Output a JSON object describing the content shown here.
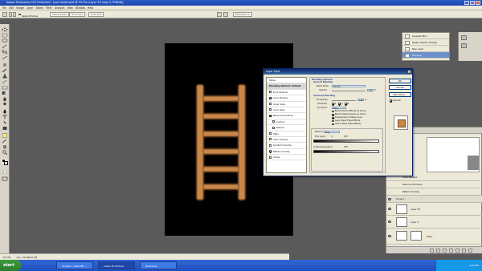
{
  "window": {
    "title": "Adobe Photoshop CS3 Extended - [sun ladder.psd @ 33.3% (Layer 32 copy 5, RGB/8)]",
    "controls": [
      "_",
      "□",
      "×"
    ]
  },
  "menu": [
    "File",
    "Edit",
    "Image",
    "Layer",
    "Select",
    "Filter",
    "Analysis",
    "View",
    "Window",
    "Help"
  ],
  "options_bar": {
    "resize_windows_label": "Resize Windows",
    "btn_actual_pixels": "Actual Pixels",
    "btn_fit_screen": "Fit Screen",
    "btn_print_size": "Print Size",
    "workspace_label": "Workspace ▾"
  },
  "status": {
    "zoom": "33.33%",
    "doc": "Doc: 30.4M/93.4M"
  },
  "history": {
    "items": [
      "Gaussian Blur",
      "Raster Opacity Change",
      "New Layer",
      "Fill Layer"
    ],
    "selected_index": 3
  },
  "layer_style": {
    "title": "Layer Style",
    "styles": [
      {
        "label": "Styles",
        "head": false,
        "check": null
      },
      {
        "label": "Blending Options: Default",
        "head": true,
        "check": null
      },
      {
        "label": "Drop Shadow",
        "head": false,
        "check": false
      },
      {
        "label": "Inner Shadow",
        "head": false,
        "check": true
      },
      {
        "label": "Outer Glow",
        "head": false,
        "check": false
      },
      {
        "label": "Inner Glow",
        "head": false,
        "check": false
      },
      {
        "label": "Bevel and Emboss",
        "head": false,
        "check": true
      },
      {
        "label": "Contour",
        "head": false,
        "check": false,
        "indent": true
      },
      {
        "label": "Texture",
        "head": false,
        "check": false,
        "indent": true
      },
      {
        "label": "Satin",
        "head": false,
        "check": false
      },
      {
        "label": "Color Overlay",
        "head": false,
        "check": false
      },
      {
        "label": "Gradient Overlay",
        "head": false,
        "check": false
      },
      {
        "label": "Pattern Overlay",
        "head": false,
        "check": true
      },
      {
        "label": "Stroke",
        "head": false,
        "check": false
      }
    ],
    "blending_options_title": "Blending Options",
    "general_blending": "General Blending",
    "blend_mode_label": "Blend Mode:",
    "blend_mode_value": "Normal",
    "opacity_label": "Opacity:",
    "opacity_value": "100",
    "advanced_blending": "Advanced Blending",
    "fill_opacity_label": "Fill Opacity:",
    "fill_opacity_value": "100",
    "channels_label": "Channels:",
    "channels": [
      "R",
      "G",
      "B"
    ],
    "knockout_label": "Knockout:",
    "knockout_value": "None",
    "adv_checks": [
      {
        "label": "Blend Interior Effects as Group",
        "on": false
      },
      {
        "label": "Blend Clipped Layers as Group",
        "on": true
      },
      {
        "label": "Transparency Shapes Layer",
        "on": true
      },
      {
        "label": "Layer Mask Hides Effects",
        "on": false
      },
      {
        "label": "Vector Mask Hides Effects",
        "on": false
      }
    ],
    "blend_if_label": "Blend If:",
    "blend_if_value": "Gray",
    "this_layer_label": "This Layer:",
    "this_layer_low": "0",
    "this_layer_high": "255",
    "underlying_label": "Underlying Layer:",
    "underlying_low": "0",
    "underlying_high": "255",
    "buttons": {
      "ok": "OK",
      "cancel": "Cancel",
      "new_style": "New Style...",
      "preview": "Preview"
    },
    "preview_on": true
  },
  "layers_panel": {
    "rows": [
      {
        "label": "Inner Shadow"
      },
      {
        "label": "Bevel and Emboss"
      },
      {
        "label": "Pattern Overlay"
      },
      {
        "label": "Group 1"
      },
      {
        "label": "Layer 28"
      },
      {
        "label": "Layer 5"
      },
      {
        "label": "Shap.."
      }
    ]
  },
  "taskbar": {
    "start": "start",
    "items": [
      "YouTube - SetzedPh...",
      "Adobe Photoshop...",
      "Photoshop"
    ],
    "active_index": 1,
    "clock": "3:22 PM"
  },
  "colors": {
    "ladder": "#c8884a",
    "ladder_edge": "#7a4a20",
    "ladder_glow": "#f0c080",
    "canvas_bg": "#000000",
    "workspace_bg": "#5a5a5a"
  }
}
